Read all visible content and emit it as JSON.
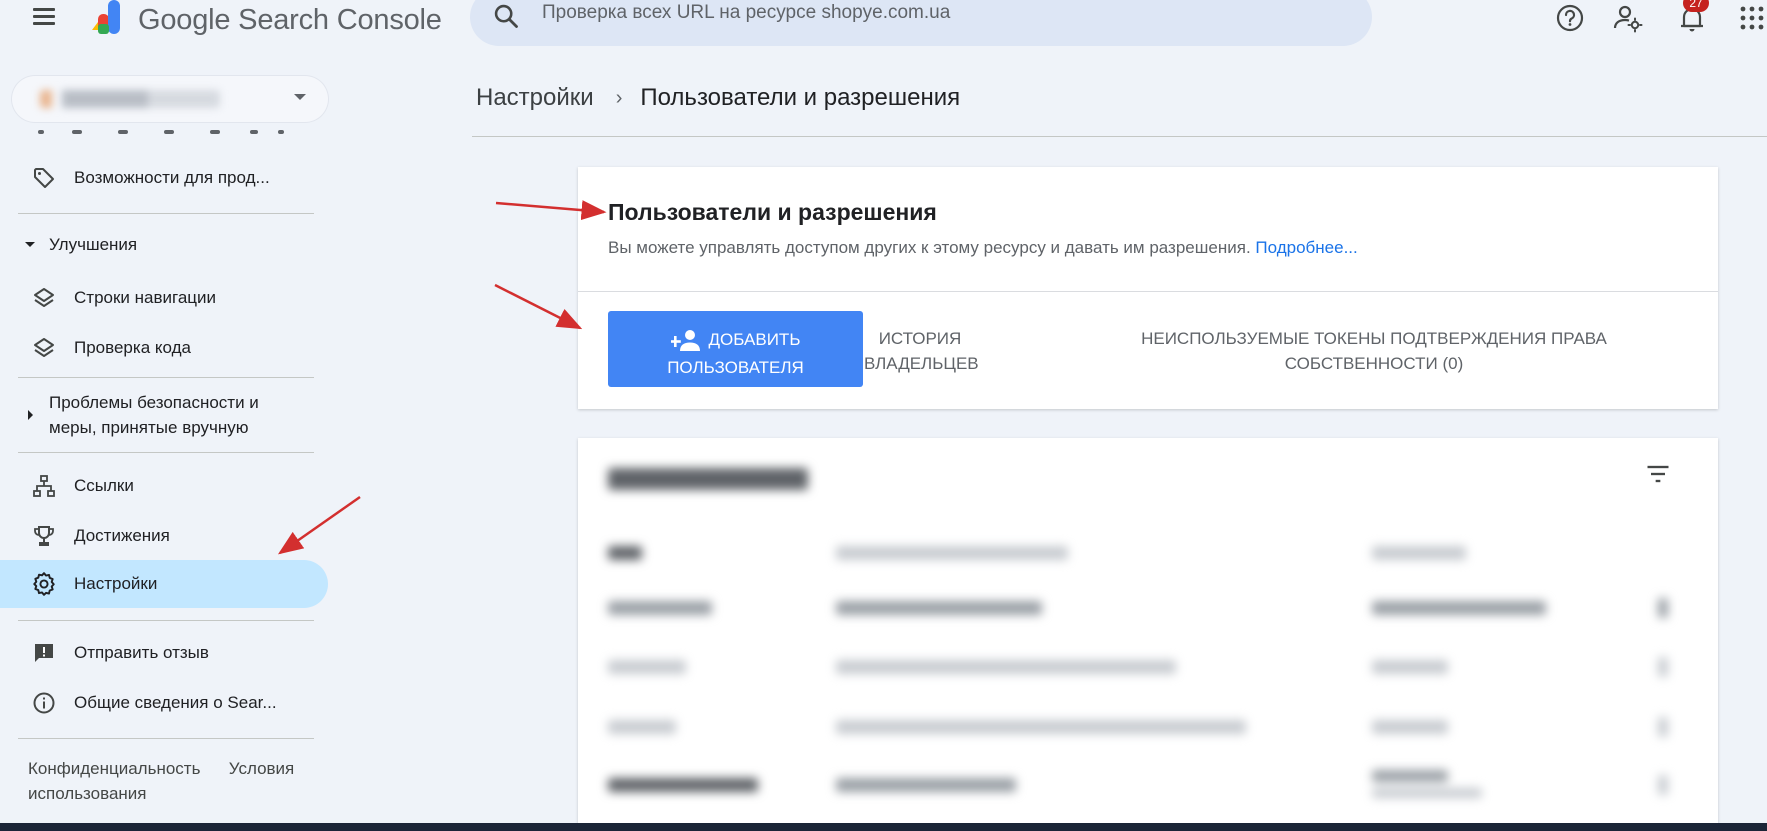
{
  "app": {
    "product_name": "Google Search Console",
    "notifications_count": "27"
  },
  "search": {
    "placeholder": "Проверка всех URL на ресурсе shopye.com.ua"
  },
  "sidebar": {
    "items": {
      "merchant": "Возможности для прод...",
      "enhancements_header": "Улучшения",
      "breadcrumbs": "Строки навигации",
      "code_check": "Проверка кода",
      "security_header": "Проблемы безопасности и меры, принятые вручную",
      "links": "Ссылки",
      "achievements": "Достижения",
      "settings": "Настройки",
      "feedback": "Отправить отзыв",
      "about": "Общие сведения о Sear..."
    },
    "footer": {
      "privacy": "Конфиденциальность",
      "terms": "Условия использования"
    }
  },
  "breadcrumb": {
    "parent": "Настройки",
    "current": "Пользователи и разрешения"
  },
  "card": {
    "title": "Пользователи и разрешения",
    "description": "Вы можете управлять доступом других к этому ресурсу и давать им разрешения.",
    "learn_more": "Подробнее...",
    "add_user_line1": "ДОБАВИТЬ",
    "add_user_line2": "ПОЛЬЗОВАТЕЛЯ",
    "owner_history_line1": "ИСТОРИЯ",
    "owner_history_line2": "ВЛАДЕЛЬЦЕВ",
    "unused_tokens_line1": "НЕИСПОЛЬЗУЕМЫЕ ТОКЕНЫ ПОДТВЕРЖДЕНИЯ ПРАВА",
    "unused_tokens_line2": "СОБСТВЕННОСТИ (0)"
  },
  "colors": {
    "accent": "#4285f4",
    "link": "#1a73e8",
    "active_nav": "#c2e7ff",
    "annotation_arrow": "#d32f2f",
    "background": "#eff3f9"
  },
  "icons": {
    "menu": "hamburger-icon",
    "search": "search-icon",
    "help": "help-icon",
    "manage_accounts": "manage-accounts-icon",
    "notifications": "bell-icon",
    "apps": "apps-grid-icon",
    "filter": "filter-icon"
  }
}
